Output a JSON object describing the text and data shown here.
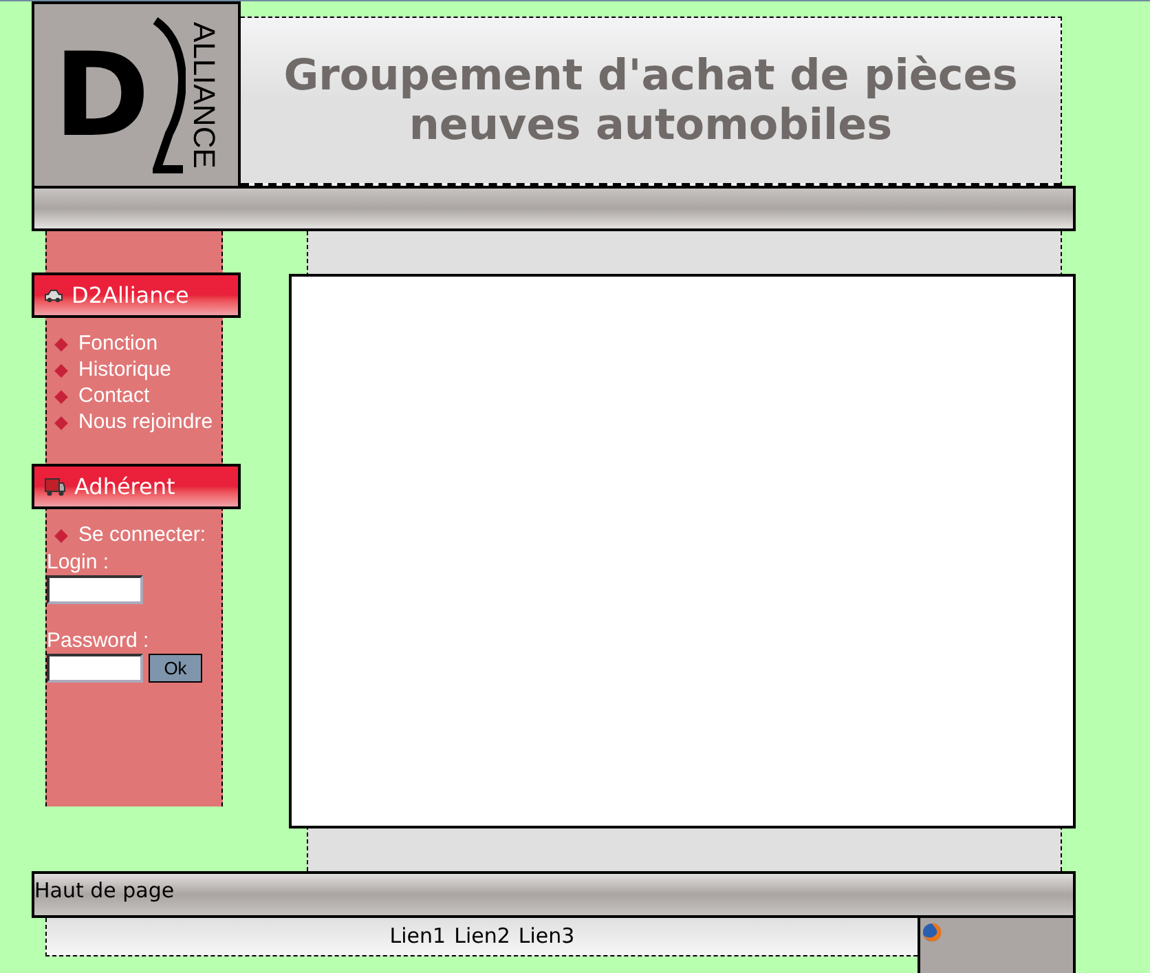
{
  "header": {
    "logo": {
      "letter": "D",
      "word": "ALLIANCE"
    },
    "title": "Groupement d'achat de pièces neuves automobiles"
  },
  "sidebar": [
    {
      "title": "D2Alliance",
      "kind": "menu",
      "links": [
        "Fonction",
        "Historique",
        "Contact",
        "Nous rejoindre"
      ]
    },
    {
      "title": "Adhérent",
      "kind": "login",
      "links": [
        "Se connecter:"
      ],
      "form": {
        "login_label": "Login :",
        "password_label": "Password :",
        "button": "Ok"
      }
    }
  ],
  "footer": {
    "top_link": "Haut de page",
    "links": [
      "Lien1",
      "Lien2",
      "Lien3"
    ]
  }
}
